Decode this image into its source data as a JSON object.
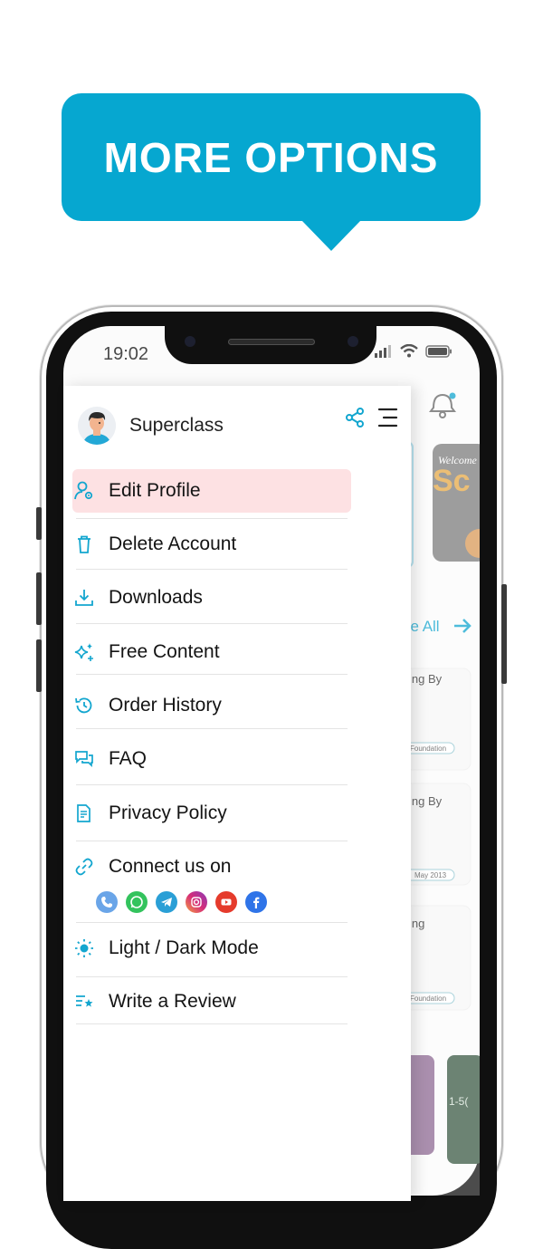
{
  "banner": {
    "title": "MORE OPTIONS"
  },
  "status_bar": {
    "time": "19:02"
  },
  "drawer": {
    "app_name": "Superclass",
    "items": [
      {
        "label": "Edit Profile",
        "icon": "user-gear-icon",
        "active": true
      },
      {
        "label": "Delete Account",
        "icon": "trash-icon"
      },
      {
        "label": "Downloads",
        "icon": "download-icon"
      },
      {
        "label": "Free Content",
        "icon": "sparkle-icon"
      },
      {
        "label": "Order History",
        "icon": "history-icon"
      },
      {
        "label": "FAQ",
        "icon": "chat-bubbles-icon"
      },
      {
        "label": "Privacy Policy",
        "icon": "document-icon"
      },
      {
        "label": "Connect us on",
        "icon": "link-icon"
      },
      {
        "label_light": "Light",
        "label_sep": " / ",
        "label_dark": "Dark Mode",
        "icon": "sun-icon"
      },
      {
        "label": "Write a Review",
        "icon": "review-star-icon"
      }
    ],
    "social": [
      "phone",
      "whatsapp",
      "telegram",
      "instagram",
      "youtube",
      "facebook"
    ]
  },
  "background_app": {
    "see_all": "ee All",
    "card1_text": "ing By",
    "card1_tag": "Foundation",
    "card2_text": "ing By",
    "card2_tag": "May 2013",
    "card3_text": "ing",
    "card3_tag": "Foundation",
    "promo_text": "Sc",
    "promo_small": "Welcome"
  },
  "colors": {
    "accent": "#13a6cf",
    "banner": "#06a7d0",
    "active_bg": "#fde1e3"
  }
}
